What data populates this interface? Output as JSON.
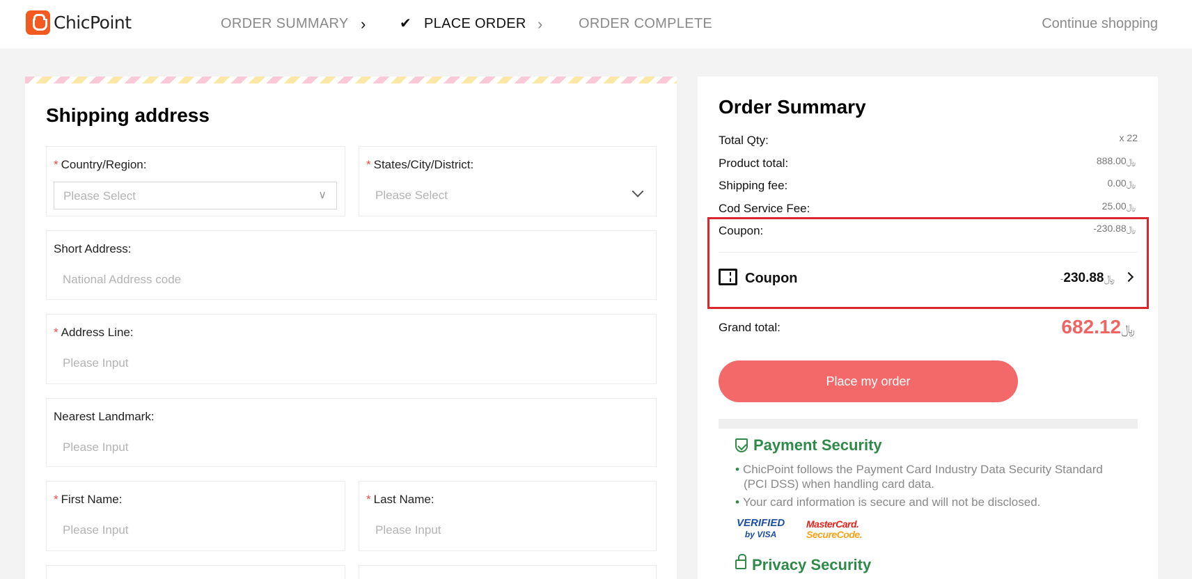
{
  "header": {
    "brand": "ChicPoint",
    "steps": [
      "ORDER SUMMARY",
      "PLACE ORDER",
      "ORDER COMPLETE"
    ],
    "active_step": "PLACE ORDER",
    "continue_shopping": "Continue shopping"
  },
  "shipping": {
    "title": "Shipping address",
    "country_label": "Country/Region:",
    "country_placeholder": "Please Select",
    "state_label": "States/City/District:",
    "state_placeholder": "Please Select",
    "short_address_label": "Short Address:",
    "short_address_placeholder": "National Address code",
    "address_line_label": "Address Line:",
    "address_line_placeholder": "Please Input",
    "landmark_label": "Nearest Landmark:",
    "landmark_placeholder": "Please Input",
    "first_name_label": "First Name:",
    "first_name_placeholder": "Please Input",
    "last_name_label": "Last Name:",
    "last_name_placeholder": "Please Input",
    "required_mark": "*"
  },
  "summary": {
    "title": "Order Summary",
    "currency_symbol": "﷼",
    "total_qty_label": "Total Qty:",
    "total_qty_value": "x 22",
    "product_total_label": "Product total:",
    "product_total_value": "888.00",
    "shipping_fee_label": "Shipping fee:",
    "shipping_fee_value": "0.00",
    "cod_fee_label": "Cod Service Fee:",
    "cod_fee_value": "25.00",
    "coupon_label": "Coupon:",
    "coupon_value": "230.88",
    "coupon_sign": "-",
    "coupon_row_label": "Coupon",
    "coupon_row_value": "230.88",
    "grand_total_label": "Grand total:",
    "grand_total_value": "682.12",
    "place_order_button": "Place my order"
  },
  "security": {
    "payment_title": "Payment Security",
    "payment_points": [
      "ChicPoint follows the Payment Card Industry Data Security Standard (PCI DSS) when handling card data.",
      "Your card information is secure and will not be disclosed."
    ],
    "bullet": "•",
    "visa_line1": "VERIFIED",
    "visa_line2": "by VISA",
    "mc_line1": "MasterCard.",
    "mc_line2": "SecureCode.",
    "privacy_title": "Privacy Security"
  },
  "colors": {
    "brand": "#f25a1f",
    "accent": "#f36969",
    "security_green": "#2f8a4a",
    "highlight_red": "#d9262f"
  }
}
